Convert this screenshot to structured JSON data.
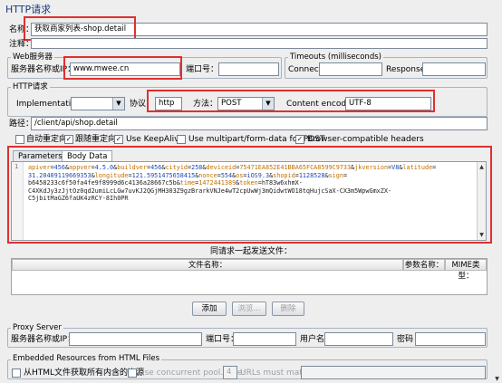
{
  "panel_title": "HTTP请求",
  "name_label": "名称：",
  "name_value": "获取商家列表-shop.detail",
  "comment_label": "注释：",
  "web_server": {
    "legend": "Web服务器",
    "server_label": "服务器名称或IP：",
    "server_value": "www.mwee.cn",
    "port_label": "端口号：",
    "port_value": ""
  },
  "timeouts": {
    "legend": "Timeouts (milliseconds)",
    "connect_label": "Connect:",
    "connect_value": "",
    "response_label": "Response:",
    "response_value": ""
  },
  "http_request": {
    "legend": "HTTP请求",
    "implementation_label": "Implementation:",
    "implementation_value": "",
    "protocol_label": "协议：",
    "protocol_value": "http",
    "method_label": "方法：",
    "method_value": "POST",
    "encoding_label": "Content encoding:",
    "encoding_value": "UTF-8",
    "path_label": "路径：",
    "path_value": "/client/api/shop.detail"
  },
  "options": {
    "redirect_auto": "自动重定向",
    "follow_redirects": "跟随重定向",
    "keepalive": "Use KeepAlive",
    "multipart": "Use multipart/form-data for POST",
    "browser_headers": "Browser-compatible headers"
  },
  "tabs": {
    "parameters": "Parameters",
    "body_data": "Body Data"
  },
  "body": {
    "line_number": "1",
    "line1_segments": [
      {
        "t": "apiver",
        "c": "orange"
      },
      {
        "t": "=",
        "c": "black"
      },
      {
        "t": "456",
        "c": "blue"
      },
      {
        "t": "&",
        "c": "black"
      },
      {
        "t": "appver",
        "c": "orange"
      },
      {
        "t": "=",
        "c": "black"
      },
      {
        "t": "4.5.0",
        "c": "blue"
      },
      {
        "t": "&",
        "c": "black"
      },
      {
        "t": "buildver",
        "c": "orange"
      },
      {
        "t": "=",
        "c": "black"
      },
      {
        "t": "456",
        "c": "blue"
      },
      {
        "t": "&",
        "c": "black"
      },
      {
        "t": "cityid",
        "c": "orange"
      },
      {
        "t": "=",
        "c": "black"
      },
      {
        "t": "258",
        "c": "blue"
      },
      {
        "t": "&",
        "c": "black"
      },
      {
        "t": "deviceid",
        "c": "orange"
      },
      {
        "t": "=",
        "c": "black"
      },
      {
        "t": "75471EA852E41BBA65FCA8599C9733",
        "c": "orange"
      },
      {
        "t": "&",
        "c": "black"
      },
      {
        "t": "jkversion",
        "c": "orange"
      },
      {
        "t": "=",
        "c": "black"
      },
      {
        "t": "V8",
        "c": "blue"
      },
      {
        "t": "&",
        "c": "black"
      },
      {
        "t": "latitude",
        "c": "orange"
      },
      {
        "t": "=",
        "c": "black"
      }
    ],
    "line2_segments": [
      {
        "t": "31.20409119669353",
        "c": "blue"
      },
      {
        "t": "&",
        "c": "black"
      },
      {
        "t": "longitude",
        "c": "orange"
      },
      {
        "t": "=",
        "c": "black"
      },
      {
        "t": "121.5951475658415",
        "c": "blue"
      },
      {
        "t": "&",
        "c": "black"
      },
      {
        "t": "nonce",
        "c": "orange"
      },
      {
        "t": "=",
        "c": "black"
      },
      {
        "t": "554",
        "c": "blue"
      },
      {
        "t": "&",
        "c": "black"
      },
      {
        "t": "os",
        "c": "orange"
      },
      {
        "t": "=",
        "c": "black"
      },
      {
        "t": "iOS9.3",
        "c": "blue"
      },
      {
        "t": "&",
        "c": "black"
      },
      {
        "t": "shopid",
        "c": "orange"
      },
      {
        "t": "=",
        "c": "black"
      },
      {
        "t": "1128528",
        "c": "blue"
      },
      {
        "t": "&",
        "c": "black"
      },
      {
        "t": "sign",
        "c": "orange"
      },
      {
        "t": "=",
        "c": "black"
      }
    ],
    "line3_segments": [
      {
        "t": "b6458233c6f50fa4fe9f8999d6c4136a28667c5b",
        "c": "black"
      },
      {
        "t": "&",
        "c": "black"
      },
      {
        "t": "time",
        "c": "orange"
      },
      {
        "t": "=",
        "c": "black"
      },
      {
        "t": "1472441389",
        "c": "orange"
      },
      {
        "t": "&",
        "c": "black"
      },
      {
        "t": "token",
        "c": "orange"
      },
      {
        "t": "=",
        "c": "black"
      },
      {
        "t": "hT83w6xhmX-",
        "c": "black"
      }
    ],
    "line4": "C4XKdJy3zJjtOz0qd2umiLcLGw7uvKJ2QGjMH303Z9gzBrarkVNJe4wT2cpUwWj3mQidwtWO18tqHujcSaX-CX3m5WpwGmxZX-",
    "line5": "C5jbitMaGZ6faUK4zRCY-8Ih0PR"
  },
  "files": {
    "title": "同请求一起发送文件：",
    "col_filename": "文件名称：",
    "col_param": "参数名称：",
    "col_mime": "MIME类型："
  },
  "buttons": {
    "add": "添加",
    "browse": "浏览...",
    "delete": "删除"
  },
  "proxy": {
    "legend": "Proxy Server",
    "server_label": "服务器名称或IP：",
    "port_label": "端口号：",
    "user_label": "用户名",
    "password_label": "密码"
  },
  "embedded": {
    "legend": "Embedded Resources from HTML Files",
    "fetch_all": "从HTML文件获取所有内含的资源",
    "concurrent": "Use concurrent pool. Size:",
    "pool_size": "4",
    "urls_match": "URLs must match:"
  }
}
